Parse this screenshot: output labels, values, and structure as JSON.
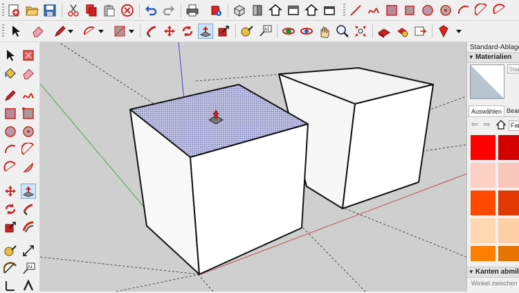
{
  "tray": {
    "title": "Standard-Ablage",
    "materials_header": "Materialien",
    "material_name_field": "Stand",
    "tab_select": "Auswählen",
    "tab_edit": "Bearb",
    "collection_field": "Far",
    "edges_header": "Kanten abmild",
    "edges_subtext": "Winkel zwischen N"
  },
  "swatches": [
    [
      "#ff0000",
      "#d40000"
    ],
    [
      "#fdd0c4",
      "#f9c6bc"
    ],
    [
      "#ff4a00",
      "#e03800"
    ],
    [
      "#ffd8b0",
      "#ffd0a8"
    ],
    [
      "#ff7f00",
      "#e87400"
    ]
  ],
  "colors": {
    "viewport_bg": "#cfcfcf",
    "red_axis": "#c04040",
    "green_axis": "#40a040",
    "blue_axis": "#3030d0",
    "selection": "#9fa3d6"
  },
  "toolbar_top_icons": [
    "new-file-icon",
    "open-folder-icon",
    "save-icon",
    "cut-icon",
    "copy-icon",
    "paste-icon",
    "erase-delete-icon",
    "undo-icon",
    "redo-icon",
    "print-icon",
    "model-info-icon",
    "iso-view-icon",
    "top-view-icon",
    "front-view-icon",
    "right-view-icon",
    "back-view-icon",
    "left-view-icon",
    "line-icon",
    "freehand-icon",
    "rectangle-icon",
    "rotated-rectangle-icon",
    "circle-icon",
    "polygon-icon",
    "arc-icon",
    "two-point-arc-icon",
    "three-point-arc-icon"
  ],
  "toolbar_second_icons": [
    "select-icon",
    "eraser-icon",
    "pencil-icon",
    "arc-tool-icon",
    "shape-icon",
    "follow-me-icon",
    "move-icon",
    "rotate-icon",
    "push-pull-icon",
    "offset-icon",
    "tape-measure-icon",
    "text-icon",
    "orbit-icon",
    "pan-icon",
    "zoom-icon",
    "zoom-extents-icon",
    "warehouse-icon",
    "extension-icon",
    "send-icon",
    "ruby-icon"
  ]
}
